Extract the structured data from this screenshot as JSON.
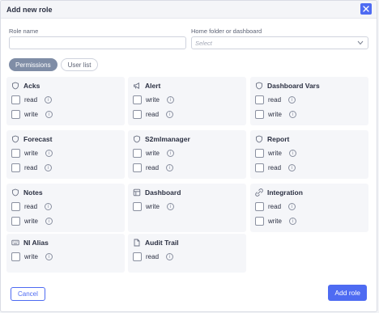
{
  "header": {
    "title": "Add new role"
  },
  "form": {
    "role_name_label": "Role name",
    "role_name_value": "",
    "home_label": "Home folder or dashboard",
    "home_placeholder": "Select"
  },
  "tabs": [
    {
      "label": "Permissions",
      "active": true
    },
    {
      "label": "User list",
      "active": false
    }
  ],
  "permissions": [
    {
      "title": "Acks",
      "icon": "shield-icon",
      "perms": [
        {
          "label": "read"
        },
        {
          "label": "write"
        }
      ]
    },
    {
      "title": "Alert",
      "icon": "megaphone-icon",
      "perms": [
        {
          "label": "write"
        },
        {
          "label": "read"
        }
      ]
    },
    {
      "title": "Dashboard Vars",
      "icon": "shield-icon",
      "perms": [
        {
          "label": "read"
        },
        {
          "label": "write"
        }
      ]
    },
    {
      "title": "Forecast",
      "icon": "shield-icon",
      "perms": [
        {
          "label": "write"
        },
        {
          "label": "read"
        }
      ]
    },
    {
      "title": "S2mlmanager",
      "icon": "shield-icon",
      "perms": [
        {
          "label": "write"
        },
        {
          "label": "read"
        }
      ]
    },
    {
      "title": "Report",
      "icon": "shield-icon",
      "perms": [
        {
          "label": "write"
        },
        {
          "label": "read"
        }
      ]
    },
    {
      "title": "Notes",
      "icon": "shield-icon",
      "perms": [
        {
          "label": "read"
        },
        {
          "label": "write"
        }
      ]
    },
    {
      "title": "Dashboard",
      "icon": "layout-icon",
      "perms": [
        {
          "label": "write"
        }
      ]
    },
    {
      "title": "Integration",
      "icon": "link-icon",
      "perms": [
        {
          "label": "read"
        },
        {
          "label": "write"
        }
      ]
    },
    {
      "title": "Nl Alias",
      "icon": "keyboard-icon",
      "perms": [
        {
          "label": "write"
        }
      ]
    },
    {
      "title": "Audit Trail",
      "icon": "document-icon",
      "perms": [
        {
          "label": "read"
        }
      ]
    }
  ],
  "footer": {
    "cancel_label": "Cancel",
    "add_label": "Add role"
  },
  "colors": {
    "accent": "#4e6bf2",
    "active_tab": "#7f8da6",
    "card_bg": "#f5f6f9"
  }
}
